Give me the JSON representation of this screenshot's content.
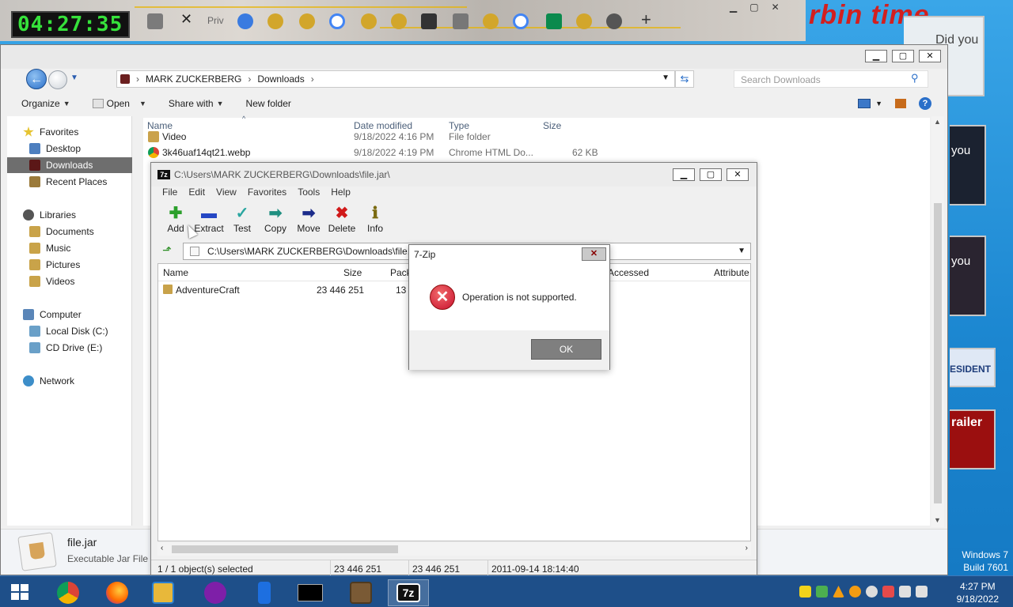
{
  "background": {
    "clock_widget": "04:27:35",
    "browser_tab_private": "Priv",
    "browser_tab_plus": "+",
    "title_text": "rbin  time",
    "side_card_1_text": "Did you",
    "side_card_2_text": "you",
    "side_card_3_text": "you",
    "side_card_4_text": "ESIDENT",
    "side_card_5_text": "railer",
    "windows_edition": "Windows 7",
    "windows_build": "Build 7601"
  },
  "explorer": {
    "breadcrumb": [
      "MARK ZUCKERBERG",
      "Downloads"
    ],
    "search_placeholder": "Search Downloads",
    "commands": {
      "organize": "Organize",
      "open": "Open",
      "share_with": "Share with",
      "new_folder": "New folder"
    },
    "nav": {
      "favorites": "Favorites",
      "desktop": "Desktop",
      "downloads": "Downloads",
      "recent_places": "Recent Places",
      "libraries": "Libraries",
      "documents": "Documents",
      "music": "Music",
      "pictures": "Pictures",
      "videos": "Videos",
      "computer": "Computer",
      "local_disk": "Local Disk (C:)",
      "cd_drive": "CD Drive (E:)",
      "network": "Network"
    },
    "columns": {
      "name": "Name",
      "date_modified": "Date modified",
      "type": "Type",
      "size": "Size"
    },
    "rows": [
      {
        "name": "Video",
        "date": "9/18/2022 4:16 PM",
        "type": "File folder",
        "size": ""
      },
      {
        "name": "3k46uaf14qt21.webp",
        "date": "9/18/2022 4:19 PM",
        "type": "Chrome HTML Do...",
        "size": "62 KB"
      }
    ],
    "details": {
      "name": "file.jar",
      "type": "Executable Jar File"
    }
  },
  "zip": {
    "title": "C:\\Users\\MARK ZUCKERBERG\\Downloads\\file.jar\\",
    "menu": [
      "File",
      "Edit",
      "View",
      "Favorites",
      "Tools",
      "Help"
    ],
    "toolbar": {
      "add": "Add",
      "extract": "Extract",
      "test": "Test",
      "copy": "Copy",
      "move": "Move",
      "delete": "Delete",
      "info": "Info"
    },
    "path": "C:\\Users\\MARK ZUCKERBERG\\Downloads\\file.jar\\",
    "columns": {
      "name": "Name",
      "size": "Size",
      "packed": "Pack",
      "accessed": "Accessed",
      "attributes": "Attribute"
    },
    "rows": [
      {
        "name": "AdventureCraft",
        "size": "23 446 251",
        "packed": "13 0"
      }
    ],
    "status": {
      "selection": "1 / 1 object(s) selected",
      "size": "23 446 251",
      "packed": "23 446 251",
      "date": "2011-09-14 18:14:40"
    }
  },
  "dialog": {
    "title": "7-Zip",
    "message": "Operation is not supported.",
    "ok_label": "OK",
    "close_label": "✕"
  },
  "taskbar": {
    "time": "4:27 PM",
    "date": "9/18/2022"
  }
}
